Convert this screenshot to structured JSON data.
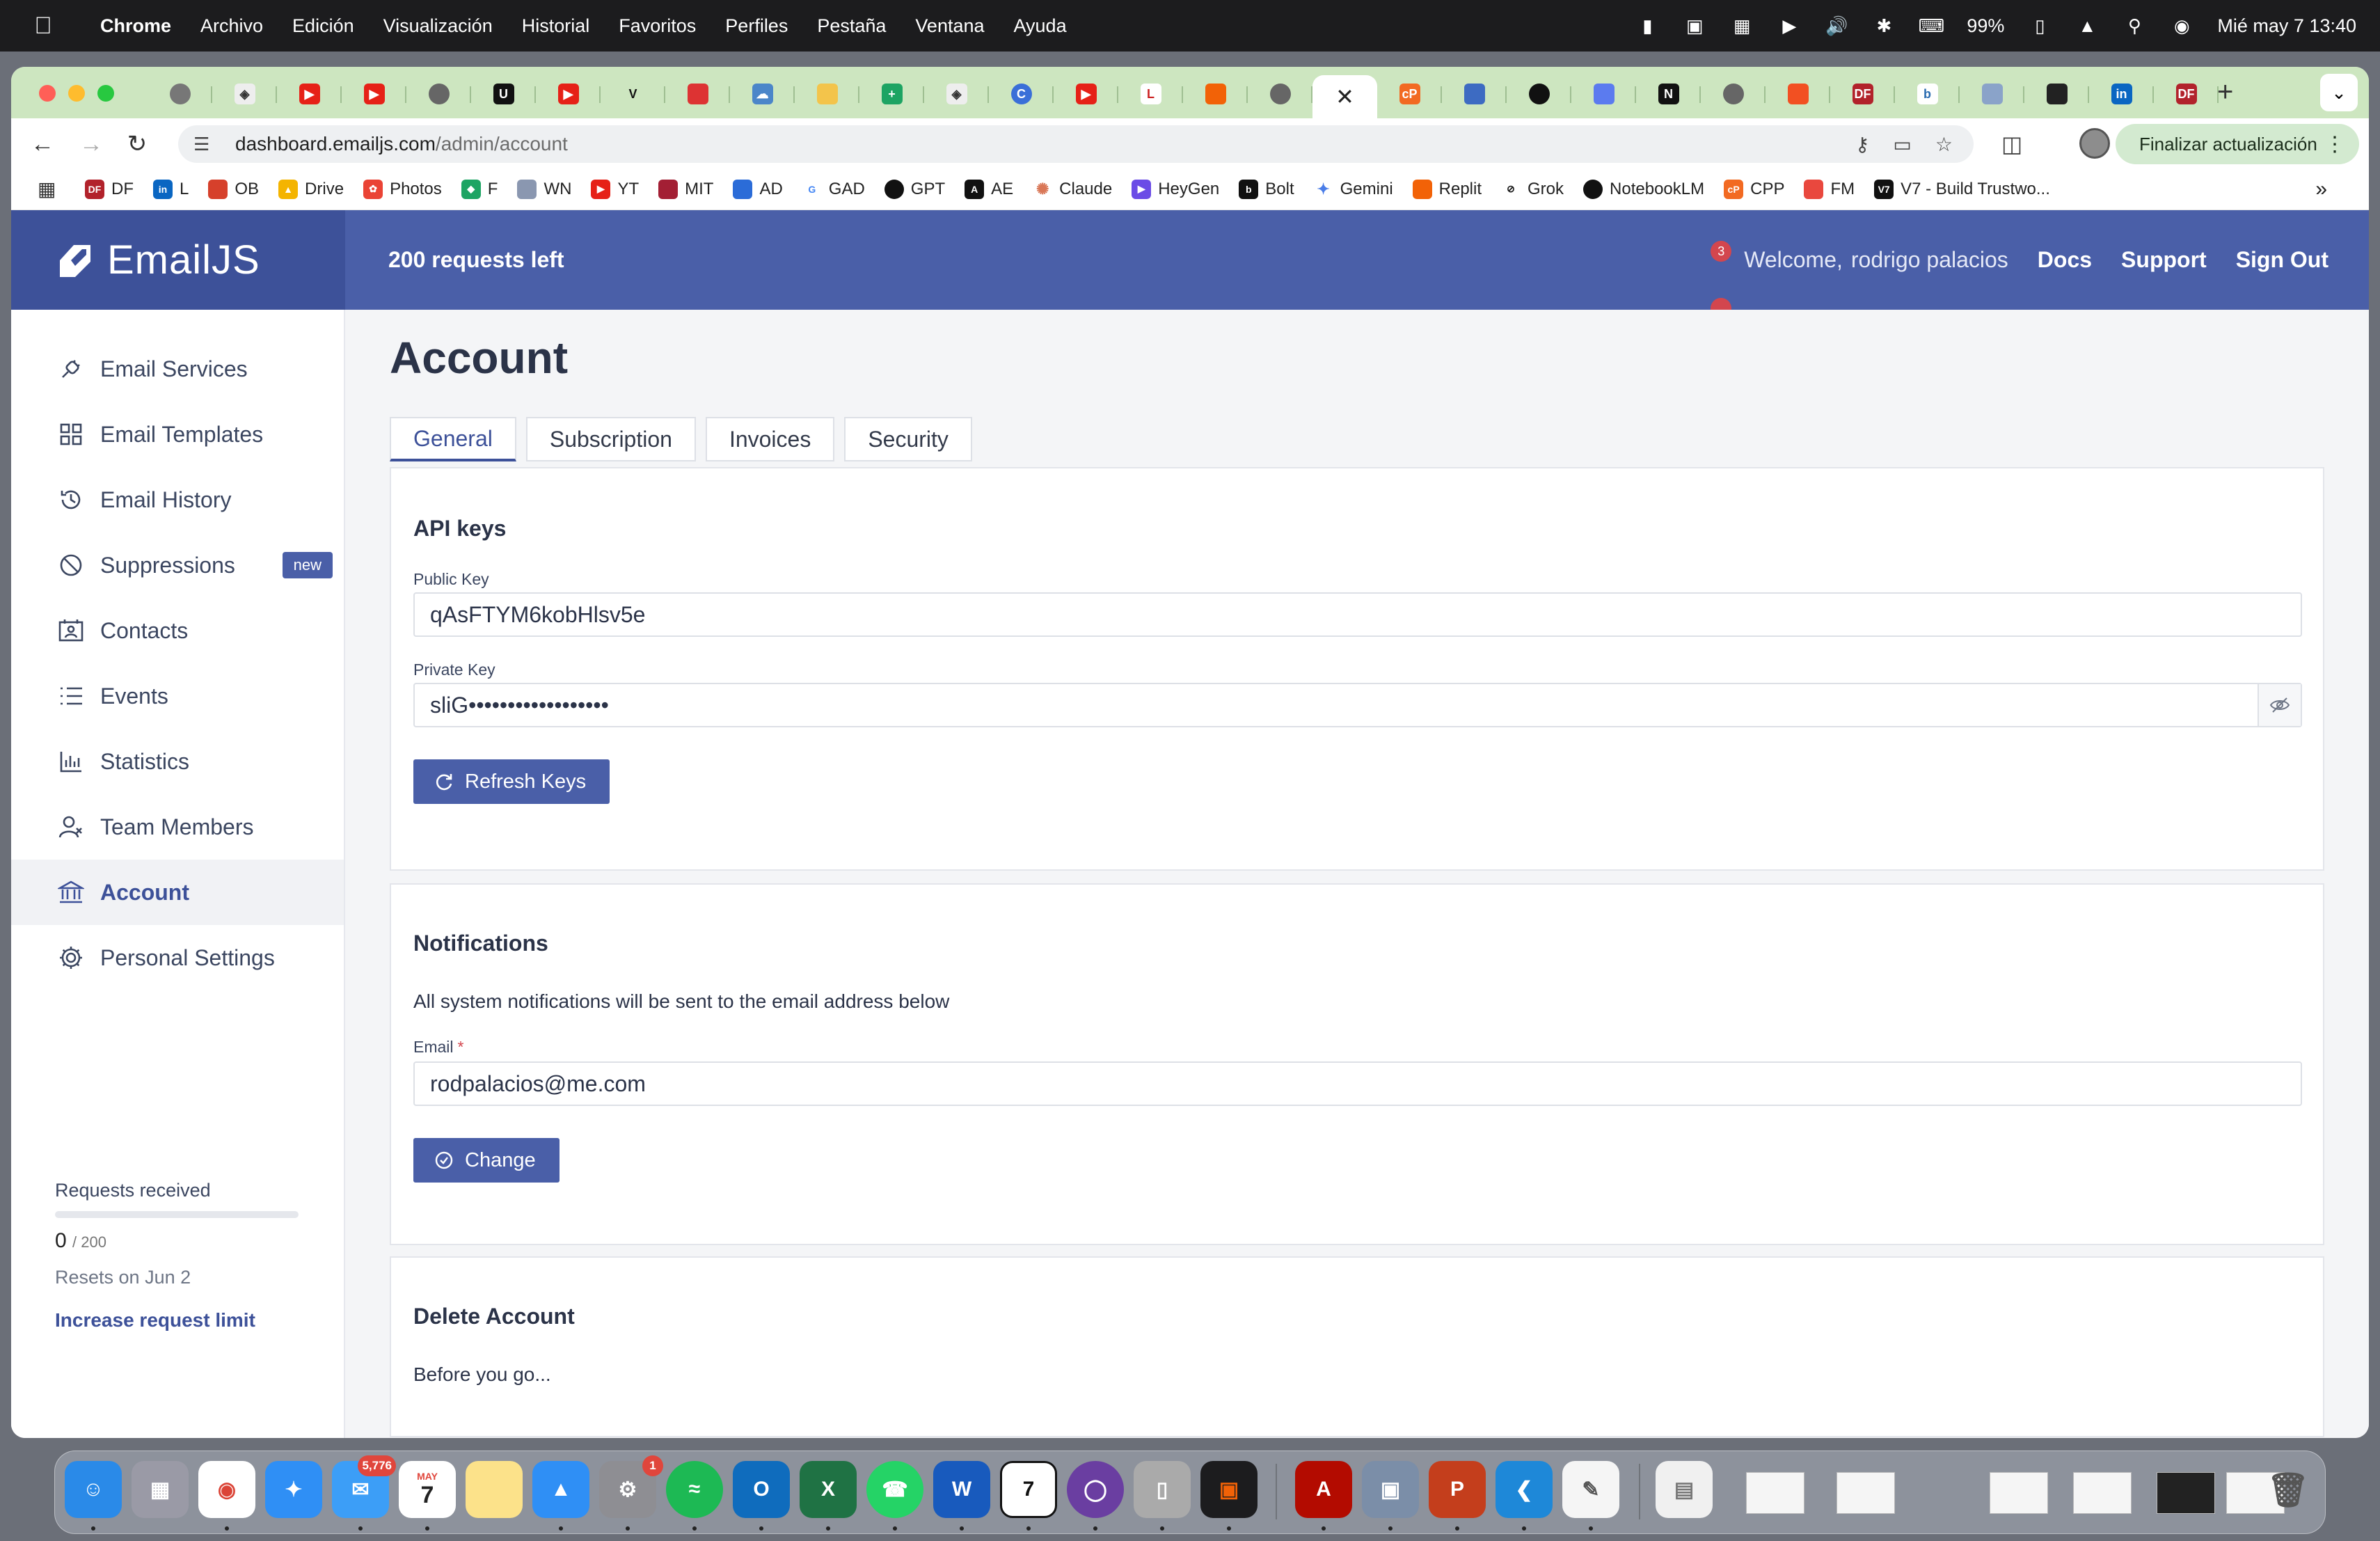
{
  "menubar": {
    "app_name": "Chrome",
    "menus": [
      "Archivo",
      "Edición",
      "Visualización",
      "Historial",
      "Favoritos",
      "Perfiles",
      "Pestaña",
      "Ventana",
      "Ayuda"
    ],
    "battery": "99%",
    "datetime": "Mié may 7  13:40"
  },
  "browser": {
    "url_host": "dashboard.emailjs.com",
    "url_path": "/admin/account",
    "update_button": "Finalizar actualización",
    "bookmarks": [
      "DF",
      "L",
      "OB",
      "Drive",
      "Photos",
      "F",
      "WN",
      "YT",
      "MIT",
      "AD",
      "GAD",
      "GPT",
      "AE",
      "Claude",
      "HeyGen",
      "Bolt",
      "Gemini",
      "Replit",
      "Grok",
      "NotebookLM",
      "CPP",
      "FM",
      "V7 - Build Trustwo..."
    ]
  },
  "header": {
    "logo": "EmailJS",
    "requests_left": "200 requests left",
    "notification_count": "3",
    "welcome": "Welcome,",
    "user_name": "rodrigo palacios",
    "docs": "Docs",
    "support": "Support",
    "sign_out": "Sign Out"
  },
  "sidebar": {
    "items": [
      {
        "label": "Email Services"
      },
      {
        "label": "Email Templates"
      },
      {
        "label": "Email History"
      },
      {
        "label": "Suppressions",
        "badge": "new"
      },
      {
        "label": "Contacts"
      },
      {
        "label": "Events"
      },
      {
        "label": "Statistics"
      },
      {
        "label": "Team Members"
      },
      {
        "label": "Account"
      },
      {
        "label": "Personal Settings"
      }
    ],
    "usage": {
      "label": "Requests received",
      "used": "0",
      "total": "/ 200",
      "fraction": 0,
      "reset": "Resets on Jun 2",
      "increase": "Increase request limit"
    }
  },
  "main": {
    "title": "Account",
    "tabs": [
      "General",
      "Subscription",
      "Invoices",
      "Security"
    ],
    "api_keys": {
      "title": "API keys",
      "public_label": "Public Key",
      "public_value": "qAsFTYM6kobHlsv5e",
      "private_label": "Private Key",
      "private_value": "sliG••••••••••••••••••",
      "refresh_button": "Refresh Keys"
    },
    "notifications": {
      "title": "Notifications",
      "description": "All system notifications will be sent to the email address below",
      "email_label": "Email",
      "required_mark": "*",
      "email_value": "rodpalacios@me.com",
      "change_button": "Change"
    },
    "delete": {
      "title": "Delete Account",
      "description": "Before you go..."
    }
  },
  "dock": {
    "mail_badge": "5,776",
    "settings_badge": "1",
    "calendar_month": "MAY",
    "calendar_day": "7"
  },
  "colors": {
    "header": "#4a5fa8",
    "accent": "#3d5199",
    "tabstrip": "#cde6c0"
  }
}
